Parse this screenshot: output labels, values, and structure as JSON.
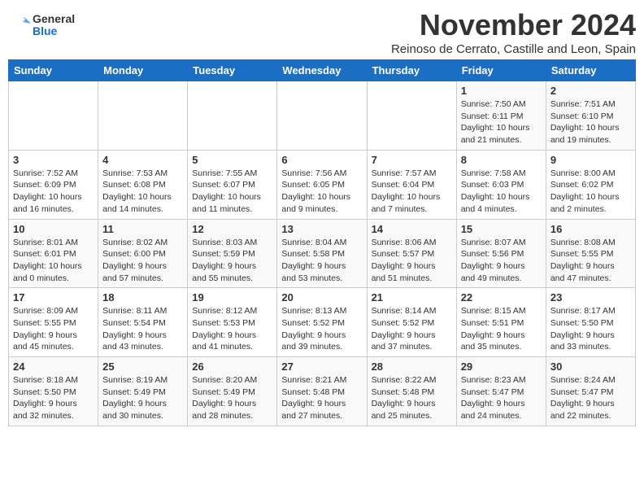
{
  "logo": {
    "line1": "General",
    "line2": "Blue"
  },
  "title": "November 2024",
  "subtitle": "Reinoso de Cerrato, Castille and Leon, Spain",
  "days_of_week": [
    "Sunday",
    "Monday",
    "Tuesday",
    "Wednesday",
    "Thursday",
    "Friday",
    "Saturday"
  ],
  "weeks": [
    {
      "days": [
        {
          "num": "",
          "info": ""
        },
        {
          "num": "",
          "info": ""
        },
        {
          "num": "",
          "info": ""
        },
        {
          "num": "",
          "info": ""
        },
        {
          "num": "",
          "info": ""
        },
        {
          "num": "1",
          "info": "Sunrise: 7:50 AM\nSunset: 6:11 PM\nDaylight: 10 hours and 21 minutes."
        },
        {
          "num": "2",
          "info": "Sunrise: 7:51 AM\nSunset: 6:10 PM\nDaylight: 10 hours and 19 minutes."
        }
      ]
    },
    {
      "days": [
        {
          "num": "3",
          "info": "Sunrise: 7:52 AM\nSunset: 6:09 PM\nDaylight: 10 hours and 16 minutes."
        },
        {
          "num": "4",
          "info": "Sunrise: 7:53 AM\nSunset: 6:08 PM\nDaylight: 10 hours and 14 minutes."
        },
        {
          "num": "5",
          "info": "Sunrise: 7:55 AM\nSunset: 6:07 PM\nDaylight: 10 hours and 11 minutes."
        },
        {
          "num": "6",
          "info": "Sunrise: 7:56 AM\nSunset: 6:05 PM\nDaylight: 10 hours and 9 minutes."
        },
        {
          "num": "7",
          "info": "Sunrise: 7:57 AM\nSunset: 6:04 PM\nDaylight: 10 hours and 7 minutes."
        },
        {
          "num": "8",
          "info": "Sunrise: 7:58 AM\nSunset: 6:03 PM\nDaylight: 10 hours and 4 minutes."
        },
        {
          "num": "9",
          "info": "Sunrise: 8:00 AM\nSunset: 6:02 PM\nDaylight: 10 hours and 2 minutes."
        }
      ]
    },
    {
      "days": [
        {
          "num": "10",
          "info": "Sunrise: 8:01 AM\nSunset: 6:01 PM\nDaylight: 10 hours and 0 minutes."
        },
        {
          "num": "11",
          "info": "Sunrise: 8:02 AM\nSunset: 6:00 PM\nDaylight: 9 hours and 57 minutes."
        },
        {
          "num": "12",
          "info": "Sunrise: 8:03 AM\nSunset: 5:59 PM\nDaylight: 9 hours and 55 minutes."
        },
        {
          "num": "13",
          "info": "Sunrise: 8:04 AM\nSunset: 5:58 PM\nDaylight: 9 hours and 53 minutes."
        },
        {
          "num": "14",
          "info": "Sunrise: 8:06 AM\nSunset: 5:57 PM\nDaylight: 9 hours and 51 minutes."
        },
        {
          "num": "15",
          "info": "Sunrise: 8:07 AM\nSunset: 5:56 PM\nDaylight: 9 hours and 49 minutes."
        },
        {
          "num": "16",
          "info": "Sunrise: 8:08 AM\nSunset: 5:55 PM\nDaylight: 9 hours and 47 minutes."
        }
      ]
    },
    {
      "days": [
        {
          "num": "17",
          "info": "Sunrise: 8:09 AM\nSunset: 5:55 PM\nDaylight: 9 hours and 45 minutes."
        },
        {
          "num": "18",
          "info": "Sunrise: 8:11 AM\nSunset: 5:54 PM\nDaylight: 9 hours and 43 minutes."
        },
        {
          "num": "19",
          "info": "Sunrise: 8:12 AM\nSunset: 5:53 PM\nDaylight: 9 hours and 41 minutes."
        },
        {
          "num": "20",
          "info": "Sunrise: 8:13 AM\nSunset: 5:52 PM\nDaylight: 9 hours and 39 minutes."
        },
        {
          "num": "21",
          "info": "Sunrise: 8:14 AM\nSunset: 5:52 PM\nDaylight: 9 hours and 37 minutes."
        },
        {
          "num": "22",
          "info": "Sunrise: 8:15 AM\nSunset: 5:51 PM\nDaylight: 9 hours and 35 minutes."
        },
        {
          "num": "23",
          "info": "Sunrise: 8:17 AM\nSunset: 5:50 PM\nDaylight: 9 hours and 33 minutes."
        }
      ]
    },
    {
      "days": [
        {
          "num": "24",
          "info": "Sunrise: 8:18 AM\nSunset: 5:50 PM\nDaylight: 9 hours and 32 minutes."
        },
        {
          "num": "25",
          "info": "Sunrise: 8:19 AM\nSunset: 5:49 PM\nDaylight: 9 hours and 30 minutes."
        },
        {
          "num": "26",
          "info": "Sunrise: 8:20 AM\nSunset: 5:49 PM\nDaylight: 9 hours and 28 minutes."
        },
        {
          "num": "27",
          "info": "Sunrise: 8:21 AM\nSunset: 5:48 PM\nDaylight: 9 hours and 27 minutes."
        },
        {
          "num": "28",
          "info": "Sunrise: 8:22 AM\nSunset: 5:48 PM\nDaylight: 9 hours and 25 minutes."
        },
        {
          "num": "29",
          "info": "Sunrise: 8:23 AM\nSunset: 5:47 PM\nDaylight: 9 hours and 24 minutes."
        },
        {
          "num": "30",
          "info": "Sunrise: 8:24 AM\nSunset: 5:47 PM\nDaylight: 9 hours and 22 minutes."
        }
      ]
    }
  ]
}
